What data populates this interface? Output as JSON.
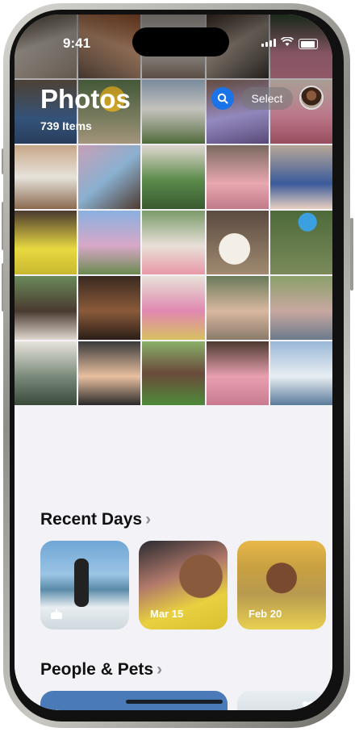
{
  "status_bar": {
    "time": "9:41"
  },
  "header": {
    "title": "Photos",
    "item_count": "739 Items",
    "select_label": "Select",
    "search_icon": "search-icon",
    "avatar_icon": "profile-avatar"
  },
  "recent_days": {
    "title": "Recent Days",
    "cards": [
      {
        "label": "",
        "icon": "shared-tray-icon"
      },
      {
        "label": "Mar 15"
      },
      {
        "label": "Feb 20"
      }
    ]
  },
  "people_pets": {
    "title": "People & Pets"
  },
  "colors": {
    "accent_blue": "#1a73e8",
    "background": "#f2f2f7"
  }
}
